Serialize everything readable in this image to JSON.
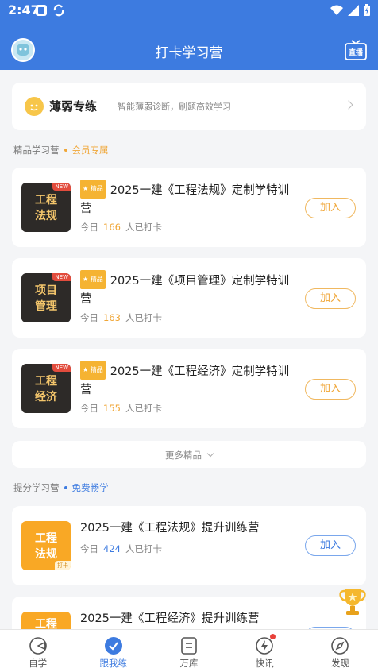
{
  "status": {
    "time": "2:47"
  },
  "header": {
    "title": "打卡学习营",
    "live_label": "直播"
  },
  "weak_practice": {
    "title": "薄弱专练",
    "desc": "智能薄弱诊断，刷题高效学习"
  },
  "premium_section": {
    "title": "精品学习营",
    "tag": "会员专属"
  },
  "premium_camps": [
    {
      "cover": "工程\n法规",
      "new_badge": "NEW",
      "badge": "精品",
      "title": "2025一建《工程法规》定制学特训营",
      "meta_prefix": "今日",
      "count": "166",
      "meta_suffix": "人已打卡",
      "button": "加入"
    },
    {
      "cover": "项目\n管理",
      "new_badge": "NEW",
      "badge": "精品",
      "title": "2025一建《项目管理》定制学特训营",
      "meta_prefix": "今日",
      "count": "163",
      "meta_suffix": "人已打卡",
      "button": "加入"
    },
    {
      "cover": "工程\n经济",
      "new_badge": "NEW",
      "badge": "精品",
      "title": "2025一建《工程经济》定制学特训营",
      "meta_prefix": "今日",
      "count": "155",
      "meta_suffix": "人已打卡",
      "button": "加入"
    }
  ],
  "more": {
    "label": "更多精品"
  },
  "free_section": {
    "title": "提分学习营",
    "tag": "免费畅学"
  },
  "free_camps": [
    {
      "cover": "工程\n法规",
      "badge": "打卡",
      "title": "2025一建《工程法规》提升训练营",
      "meta_prefix": "今日",
      "count": "424",
      "meta_suffix": "人已打卡",
      "button": "加入"
    },
    {
      "cover": "工程",
      "title": "2025一建《工程经济》提升训练营"
    }
  ],
  "tabbar": [
    {
      "label": "自学",
      "icon": "self-study-icon",
      "active": false
    },
    {
      "label": "跟我练",
      "icon": "check-circle-icon",
      "active": true
    },
    {
      "label": "万库",
      "icon": "library-icon",
      "active": false
    },
    {
      "label": "快讯",
      "icon": "lightning-icon",
      "active": false
    },
    {
      "label": "发现",
      "icon": "compass-icon",
      "active": false
    }
  ],
  "colors": {
    "primary": "#3d7be0",
    "accent": "#f0a637",
    "badge_red": "#e24c3d"
  }
}
